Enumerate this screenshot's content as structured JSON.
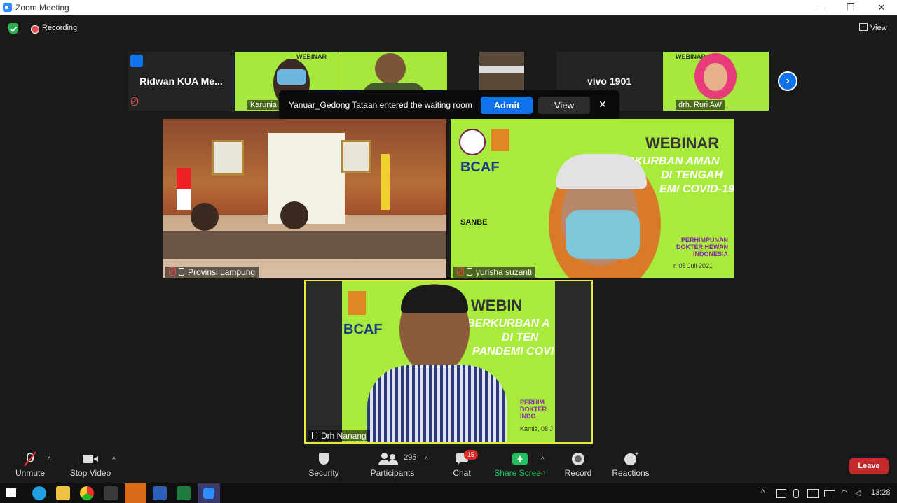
{
  "window": {
    "title": "Zoom Meeting",
    "minimize": "—",
    "restore": "❐",
    "close": "✕"
  },
  "top": {
    "recording": "Recording",
    "view": "View"
  },
  "strip": [
    {
      "name": "Ridwan KUA Me..."
    },
    {
      "label": "Karunia"
    },
    {
      "label": ""
    },
    {
      "label": ""
    },
    {
      "name": "vivo 1901"
    },
    {
      "label": "drh. Ruri AW"
    }
  ],
  "notification": {
    "message": "Yanuar_Gedong Tataan entered the waiting room",
    "admit": "Admit",
    "view": "View",
    "close": "✕"
  },
  "tiles": {
    "provinsi": {
      "label": "Provinsi Lampung"
    },
    "yurisha": {
      "label": "yurisha suzanti",
      "banner_title": "WEBINAR",
      "banner_lines": [
        "ERKURBAN AMAN",
        "DI TENGAH",
        "EMI COVID-19"
      ],
      "sponsor": "BCAF",
      "sponsor2": "SANBE",
      "org": "PERHIMPUNAN DOKTER HEWAN INDONESIA",
      "date": "r, 08 Juli 2021"
    },
    "nanang": {
      "label": "Drh Nanang",
      "banner_title": "WEBIN",
      "banner_lines": [
        "BERKURBAN A",
        "DI TEN",
        "PANDEMI COVI"
      ],
      "sponsor": "BCAF",
      "org": "PERHIM DOKTER INDO",
      "date": "Kamis, 08 J"
    }
  },
  "toolbar": {
    "unmute": "Unmute",
    "stop_video": "Stop Video",
    "security": "Security",
    "participants": "Participants",
    "participant_count": "295",
    "chat": "Chat",
    "chat_badge": "15",
    "share_screen": "Share Screen",
    "record": "Record",
    "reactions": "Reactions",
    "leave": "Leave"
  },
  "taskbar": {
    "time": "13:28"
  },
  "colors": {
    "accent": "#0e72ed",
    "share_green": "#22c15e",
    "leave_red": "#c6292b",
    "webinar_green": "#a8eb3d"
  }
}
